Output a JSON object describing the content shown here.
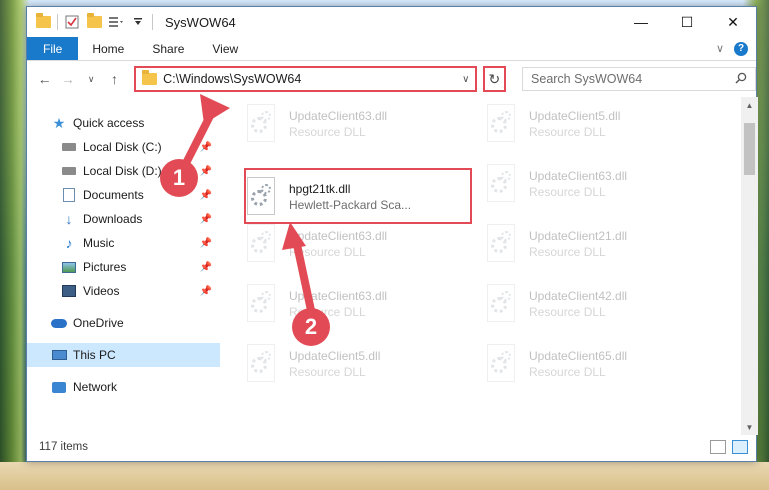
{
  "window": {
    "title": "SysWOW64",
    "controls": {
      "minimize": "—",
      "maximize": "☐",
      "close": "✕"
    }
  },
  "ribbon": {
    "tabs": [
      {
        "label": "File"
      },
      {
        "label": "Home"
      },
      {
        "label": "Share"
      },
      {
        "label": "View"
      }
    ],
    "expand_glyph": "∨",
    "help_glyph": "?"
  },
  "navbar": {
    "back": "←",
    "forward": "→",
    "recent": "∨",
    "up": "↑",
    "address": "C:\\Windows\\SysWOW64",
    "address_dropdown": "∨",
    "refresh": "↻",
    "search_placeholder": "Search SysWOW64",
    "search_icon": "magnifier-icon"
  },
  "sidebar": {
    "items": [
      {
        "label": "Quick access",
        "icon": "star-icon",
        "pinned": false
      },
      {
        "label": "Local Disk (C:)",
        "icon": "drive-icon",
        "pinned": true
      },
      {
        "label": "Local Disk (D:)",
        "icon": "drive-icon",
        "pinned": true
      },
      {
        "label": "Documents",
        "icon": "document-icon",
        "pinned": true
      },
      {
        "label": "Downloads",
        "icon": "download-icon",
        "pinned": true
      },
      {
        "label": "Music",
        "icon": "music-icon",
        "pinned": true
      },
      {
        "label": "Pictures",
        "icon": "pictures-icon",
        "pinned": true
      },
      {
        "label": "Videos",
        "icon": "videos-icon",
        "pinned": true
      },
      {
        "label": "OneDrive",
        "icon": "cloud-icon"
      },
      {
        "label": "This PC",
        "icon": "computer-icon",
        "selected": true
      },
      {
        "label": "Network",
        "icon": "network-icon"
      }
    ],
    "pin_glyph": "📌"
  },
  "files": [
    {
      "name": "UpdateClient63.dll",
      "desc": "Resource DLL"
    },
    {
      "name": "UpdateClient5.dll",
      "desc": "Resource DLL"
    },
    {
      "name": "hpgt21tk.dll",
      "desc": "Hewlett-Packard Sca..."
    },
    {
      "name": "UpdateClient63.dll",
      "desc": "Resource DLL"
    },
    {
      "name": "UpdateClient63.dll",
      "desc": "Resource DLL"
    },
    {
      "name": "UpdateClient21.dll",
      "desc": "Resource DLL"
    },
    {
      "name": "UpdateClient63.dll",
      "desc": "Resource DLL"
    },
    {
      "name": "UpdateClient42.dll",
      "desc": "Resource DLL"
    },
    {
      "name": "UpdateClient5.dll",
      "desc": "Resource DLL"
    },
    {
      "name": "UpdateClient65.dll",
      "desc": "Resource DLL"
    }
  ],
  "status": {
    "count": "117 items"
  },
  "annotations": {
    "step1": "1",
    "step2": "2",
    "color": "#e24b55"
  }
}
